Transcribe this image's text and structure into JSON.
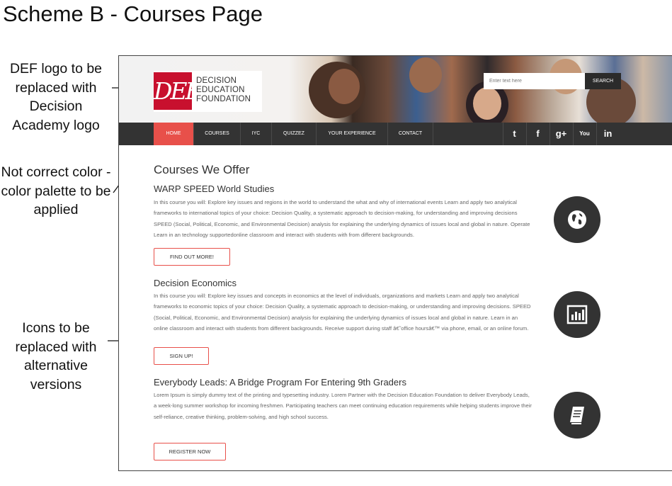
{
  "slide": {
    "title": "Scheme B - Courses Page",
    "notes": {
      "logo": "DEF logo to be replaced with Decision Academy logo",
      "color": "Not correct color - color palette to be applied",
      "icons": "Icons to be replaced with alternative versions"
    }
  },
  "site": {
    "logo": {
      "mark": "DEF",
      "line1": "DECISION",
      "line2": "EDUCATION",
      "line3": "FOUNDATION"
    },
    "search": {
      "placeholder": "Enter text here",
      "button_label": "SEARCH"
    },
    "nav": {
      "items": [
        "HOME",
        "COURSES",
        "IYC",
        "QUIZZEZ",
        "YOUR EXPERIENCE",
        "CONTACT"
      ],
      "active_index": 0,
      "social": [
        "twitter-icon",
        "facebook-icon",
        "google-plus-icon",
        "youtube-icon",
        "linkedin-icon"
      ],
      "social_glyphs": [
        "t",
        "f",
        "g+",
        "You",
        "in"
      ]
    },
    "colors": {
      "accent": "#e8504a",
      "nav_bg": "#333333",
      "circle_bg": "#333333",
      "logo_red": "#c8102e"
    },
    "main_heading": "Courses We Offer",
    "courses": [
      {
        "title": "WARP SPEED World Studies",
        "body": "In this course you will: Explore key issues and regions in the world to understand the what and why of international events Learn and apply two analytical frameworks to international topics of your choice: Decision Quality, a systematic approach to decision-making, for understanding and improving decisions SPEED (Social, Political, Economic, and Environmental Decision) analysis for explaining the underlying dynamics of issues local and global in nature. Operate Learn in an technology supportedonline classroom and interact with students with from different backgrounds.",
        "button": "FIND OUT MORE!",
        "icon": "globe-icon"
      },
      {
        "title": "Decision Economics",
        "body": "In this course you will: Explore key issues and concepts in economics at the level of individuals, organizations and markets Learn and apply two analytical frameworks to economic topics of your choice: Decision Quality, a systematic approach to decision-making, or understanding and improving decisions. SPEED (Social, Political, Economic, and Environmental Decision) analysis for explaining the underlying dynamics of issues local and global in nature. Learn in an online classroom and interact with students from different backgrounds. Receive support during staff â€˜office hoursâ€™ via phone, email, or an online forum.",
        "button": "SIGN UP!",
        "icon": "bar-chart-icon"
      },
      {
        "title": "Everybody Leads: A Bridge Program For Entering 9th Graders",
        "body": "Lorem Ipsum is simply dummy text of the printing and typesetting industry. Lorem Partner with the Decision Education Foundation to deliver Everybody Leads, a week-long summer workshop for incoming freshmen. Participating teachers can meet continuing education requirements while helping students improve their self-reliance, creative thinking, problem-solving, and high school success.",
        "button": "REGISTER NOW",
        "icon": "book-icon"
      }
    ]
  }
}
